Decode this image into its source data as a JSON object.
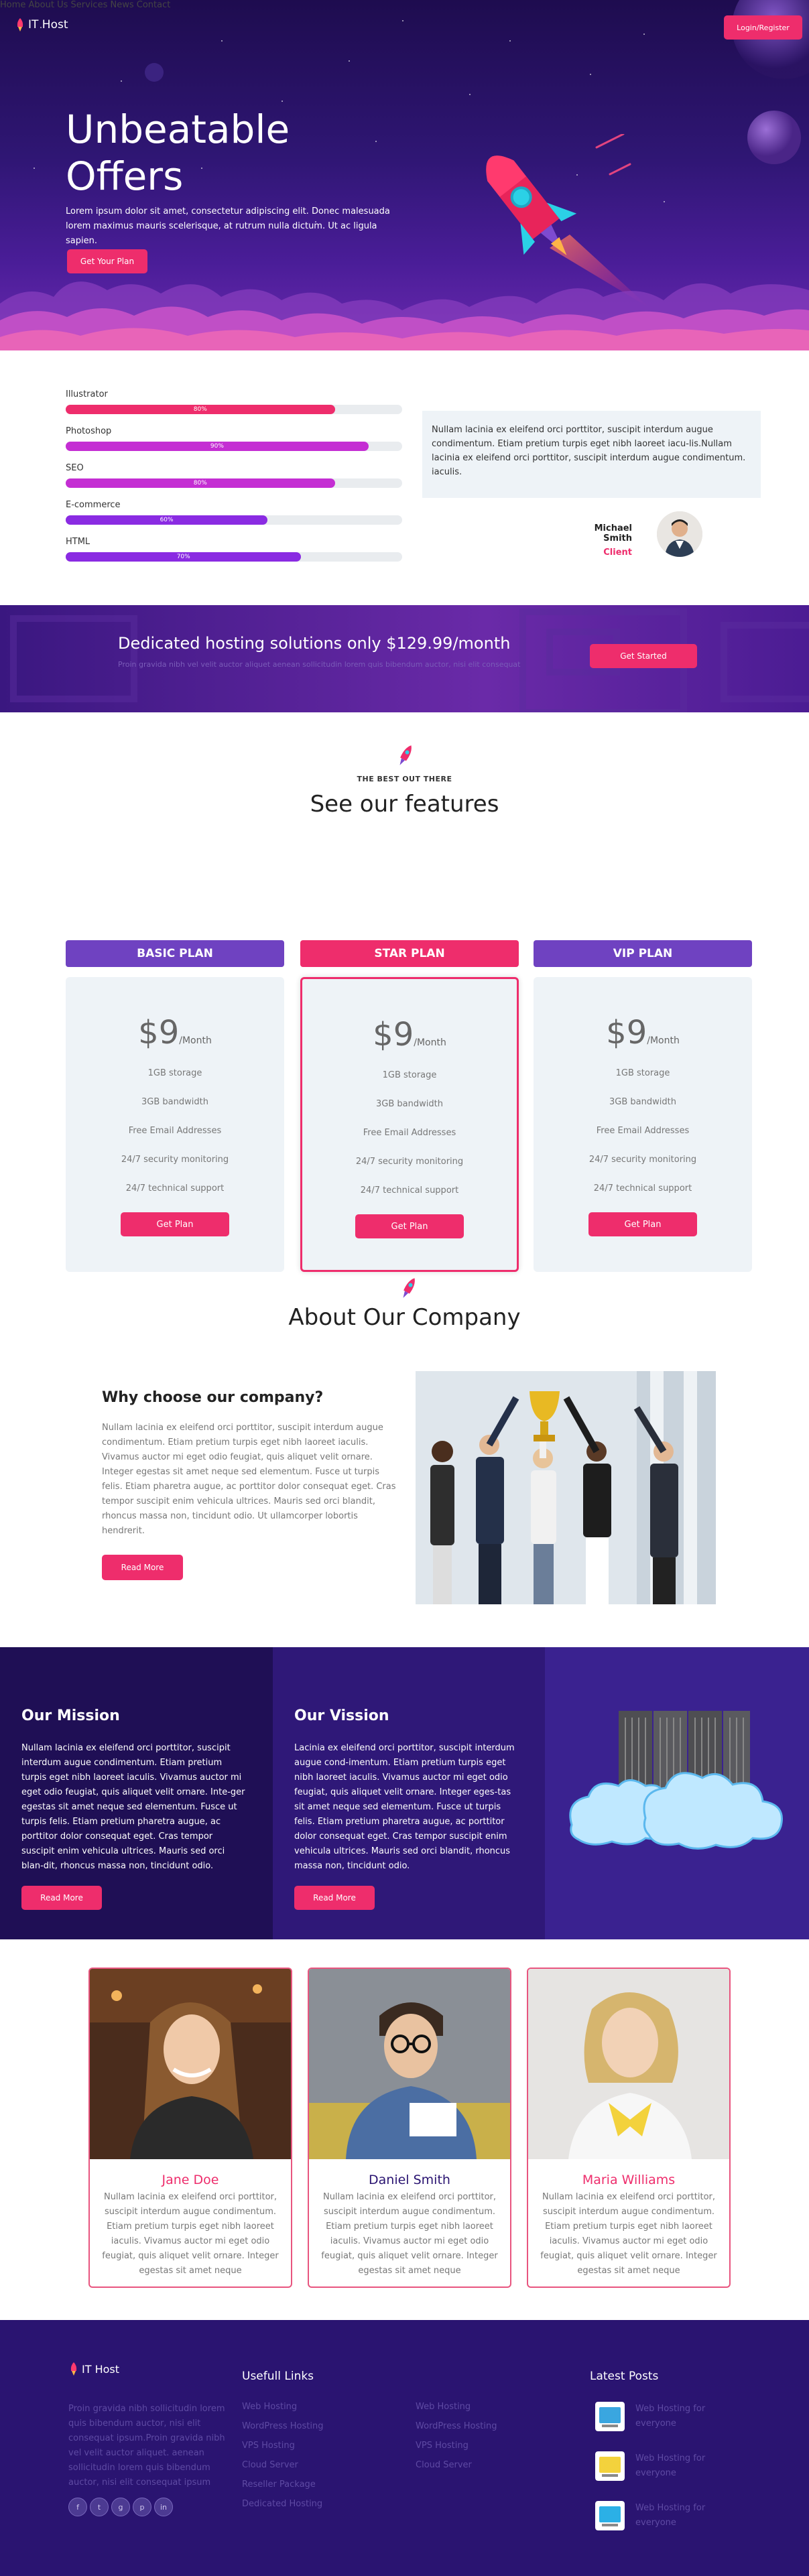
{
  "nav": {
    "brand": "IT Host",
    "items": [
      {
        "label": "Home"
      },
      {
        "label": "About Us"
      },
      {
        "label": "Services"
      },
      {
        "label": "News"
      },
      {
        "label": "Contact"
      }
    ],
    "login_label": "Login/Register"
  },
  "hero": {
    "title_line1": "Unbeatable",
    "title_line2": "Offers",
    "lead": "Lorem ipsum dolor sit amet, consectetur adipiscing elit. Donec malesuada lorem maximus mauris scelerisque, at rutrum nulla dictum. Ut ac ligula sapien.",
    "cta_label": "Get Your Plan"
  },
  "skills": {
    "items": [
      {
        "label": "Illustrator",
        "value": "80%",
        "fraction": 0.8,
        "color": "#ee2d6c"
      },
      {
        "label": "Photoshop",
        "value": "90%",
        "fraction": 0.9,
        "color": "#c42ed3"
      },
      {
        "label": "SEO",
        "value": "80%",
        "fraction": 0.8,
        "color": "#c42ed3"
      },
      {
        "label": "E-commerce",
        "value": "60%",
        "fraction": 0.6,
        "color": "#8a2be2"
      },
      {
        "label": "HTML",
        "value": "70%",
        "fraction": 0.7,
        "color": "#8a2be2"
      }
    ],
    "testimonial": {
      "text": "Nullam lacinia ex eleifend orci porttitor, suscipit interdum augue condimentum. Etiam pretium turpis eget nibh laoreet iacu-lis.Nullam lacinia ex eleifend orci porttitor, suscipit interdum augue condimentum. iaculis.",
      "name": "Michael Smith",
      "role": "Client"
    }
  },
  "banner": {
    "title": "Dedicated hosting solutions only $129.99/month",
    "sub": "Proin gravida nibh vel velit auctor aliquet aenean sollicitudin lorem quis bibendum auctor, nisi elit consequat",
    "cta_label": "Get Started"
  },
  "features": {
    "kicker": "THE BEST OUT THERE",
    "title": "See our features",
    "plans": [
      {
        "name": "BASIC PLAN",
        "price": "$9",
        "period": "/Month",
        "color": "#6f42c1",
        "items": [
          "1GB storage",
          "3GB bandwidth",
          "Free Email Addresses",
          "24/7 security monitoring",
          "24/7 technical support"
        ],
        "cta": "Get Plan"
      },
      {
        "name": "STAR PLAN",
        "price": "$9",
        "period": "/Month",
        "color": "#ee2d6c",
        "items": [
          "1GB storage",
          "3GB bandwidth",
          "Free Email Addresses",
          "24/7 security monitoring",
          "24/7 technical support"
        ],
        "cta": "Get Plan"
      },
      {
        "name": "VIP PLAN",
        "price": "$9",
        "period": "/Month",
        "color": "#6f42c1",
        "items": [
          "1GB storage",
          "3GB bandwidth",
          "Free Email Addresses",
          "24/7 security monitoring",
          "24/7 technical support"
        ],
        "cta": "Get Plan"
      }
    ]
  },
  "about": {
    "title": "About Our Company",
    "subtitle": "Why choose our company?",
    "text": "Nullam lacinia ex eleifend orci porttitor, suscipit interdum augue condimentum. Etiam pretium turpis eget nibh laoreet iaculis. Vivamus auctor mi eget odio feugiat, quis aliquet velit ornare. Integer egestas sit amet neque sed elementum. Fusce ut turpis felis. Etiam pharetra augue, ac porttitor dolor consequat eget. Cras tempor suscipit enim vehicula ultrices. Mauris sed orci blandit, rhoncus massa non, tincidunt odio. Ut ullamcorper lobortis hendrerit.",
    "cta_label": "Read More"
  },
  "mission": {
    "title": "Our Mission",
    "text": "Nullam lacinia ex eleifend orci porttitor, suscipit interdum augue condimentum. Etiam pretium turpis eget nibh laoreet iaculis. Vivamus auctor mi eget odio feugiat, quis aliquet velit ornare. Inte-ger egestas sit amet neque sed elementum. Fusce ut turpis felis. Etiam pretium pharetra augue, ac porttitor dolor consequat eget. Cras tempor suscipit enim vehicula ultrices. Mauris sed orci blan-dit, rhoncus massa non, tincidunt odio.",
    "cta_label": "Read More"
  },
  "vision": {
    "title": "Our Vission",
    "text": "Lacinia ex eleifend orci porttitor, suscipit interdum augue cond-imentum. Etiam pretium turpis eget nibh laoreet iaculis. Vivamus auctor mi eget odio feugiat, quis aliquet velit ornare. Integer eges-tas sit amet neque sed elementum. Fusce ut turpis felis. Etiam pretium pharetra augue, ac porttitor dolor consequat eget. Cras tempor suscipit enim vehicula ultrices. Mauris sed orci blandit, rhoncus massa non, tincidunt odio.",
    "cta_label": "Read More"
  },
  "team": [
    {
      "name": "Jane Doe",
      "color": "#ee2d6c",
      "bio": "Nullam lacinia ex eleifend orci porttitor, suscipit interdum augue condimentum. Etiam pretium turpis eget nibh laoreet iaculis. Vivamus auctor mi eget odio feugiat, quis aliquet velit ornare. Integer egestas sit amet neque"
    },
    {
      "name": "Daniel Smith",
      "color": "#2a1471",
      "bio": "Nullam lacinia ex eleifend orci porttitor, suscipit interdum augue condimentum. Etiam pretium turpis eget nibh laoreet iaculis. Vivamus auctor mi eget odio feugiat, quis aliquet velit ornare. Integer egestas sit amet neque"
    },
    {
      "name": "Maria Williams",
      "color": "#ee2d6c",
      "bio": "Nullam lacinia ex eleifend orci porttitor, suscipit interdum augue condimentum. Etiam pretium turpis eget nibh laoreet iaculis. Vivamus auctor mi eget odio feugiat, quis aliquet velit ornare. Integer egestas sit amet neque"
    }
  ],
  "footer": {
    "brand": "IT Host",
    "desc": "Proin gravida nibh sollicitudin lorem quis bibendum auctor, nisi elit consequat ipsum.Proin gravida nibh vel velit auctor aliquet. aenean sollicitudin lorem quis bibendum auctor, nisi elit consequat ipsum",
    "socials": [
      "facebook-icon",
      "twitter-icon",
      "google-plus-icon",
      "pinterest-icon",
      "linkedin-icon"
    ],
    "links_title": "Usefull Links",
    "links_col1": [
      "Web Hosting",
      "WordPress Hosting",
      "VPS Hosting",
      "Cloud Server",
      "Reseller Package",
      "Dedicated Hosting"
    ],
    "links_col2": [
      "Web Hosting",
      "WordPress Hosting",
      "VPS Hosting",
      "Cloud Server"
    ],
    "posts_title": "Latest Posts",
    "posts": [
      "Web Hosting for everyone",
      "Web Hosting for everyone",
      "Web Hosting for everyone"
    ]
  }
}
